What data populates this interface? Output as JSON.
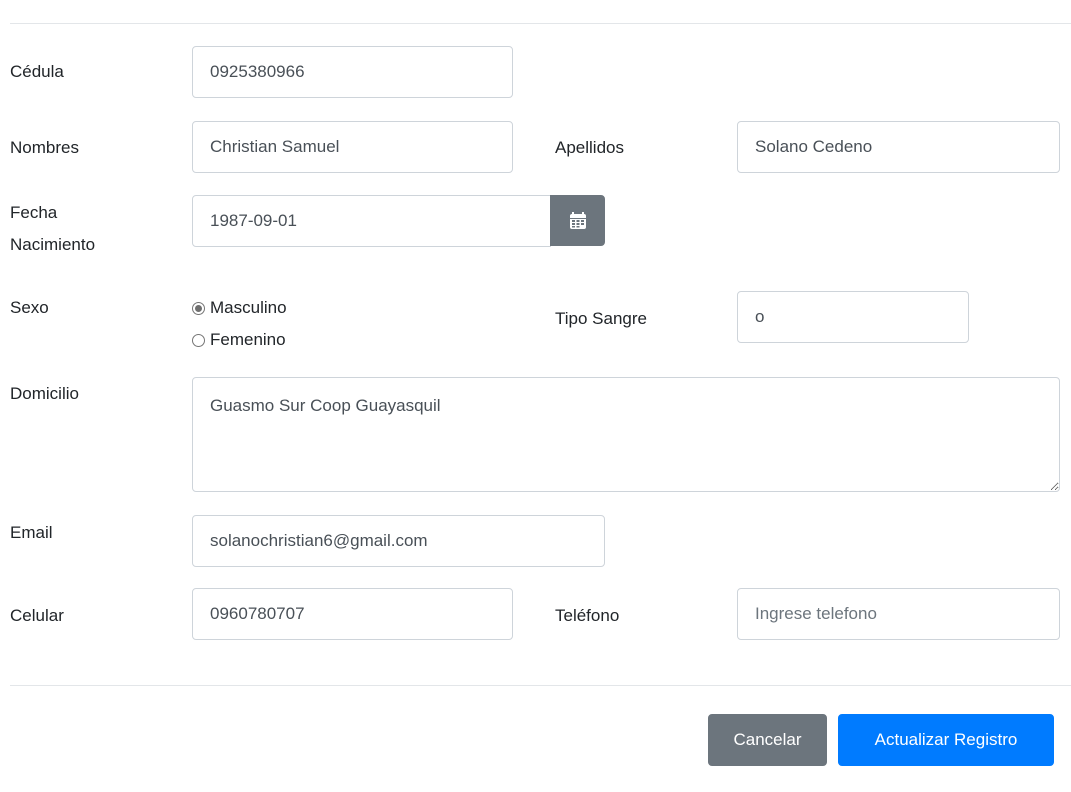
{
  "form": {
    "cedula": {
      "label": "Cédula",
      "value": "0925380966"
    },
    "nombres": {
      "label": "Nombres",
      "value": "Christian Samuel"
    },
    "apellidos": {
      "label": "Apellidos",
      "value": "Solano Cedeno"
    },
    "fecha": {
      "label_line1": "Fecha",
      "label_line2": "Nacimiento",
      "value": "1987-09-01",
      "button_icon": "calendar-icon"
    },
    "sexo": {
      "label": "Sexo",
      "options": [
        {
          "label": "Masculino",
          "checked": true
        },
        {
          "label": "Femenino",
          "checked": false
        }
      ]
    },
    "tipo_sangre": {
      "label": "Tipo Sangre",
      "value": "o"
    },
    "domicilio": {
      "label": "Domicilio",
      "value": "Guasmo Sur Coop Guayasquil"
    },
    "email": {
      "label": "Email",
      "value": "solanochristian6@gmail.com"
    },
    "celular": {
      "label": "Celular",
      "value": "0960780707"
    },
    "telefono": {
      "label": "Teléfono",
      "value": "",
      "placeholder": "Ingrese telefono"
    }
  },
  "footer": {
    "cancel_label": "Cancelar",
    "submit_label": "Actualizar Registro"
  },
  "colors": {
    "primary": "#007bff",
    "secondary": "#6c757d",
    "border": "#ced4da"
  }
}
